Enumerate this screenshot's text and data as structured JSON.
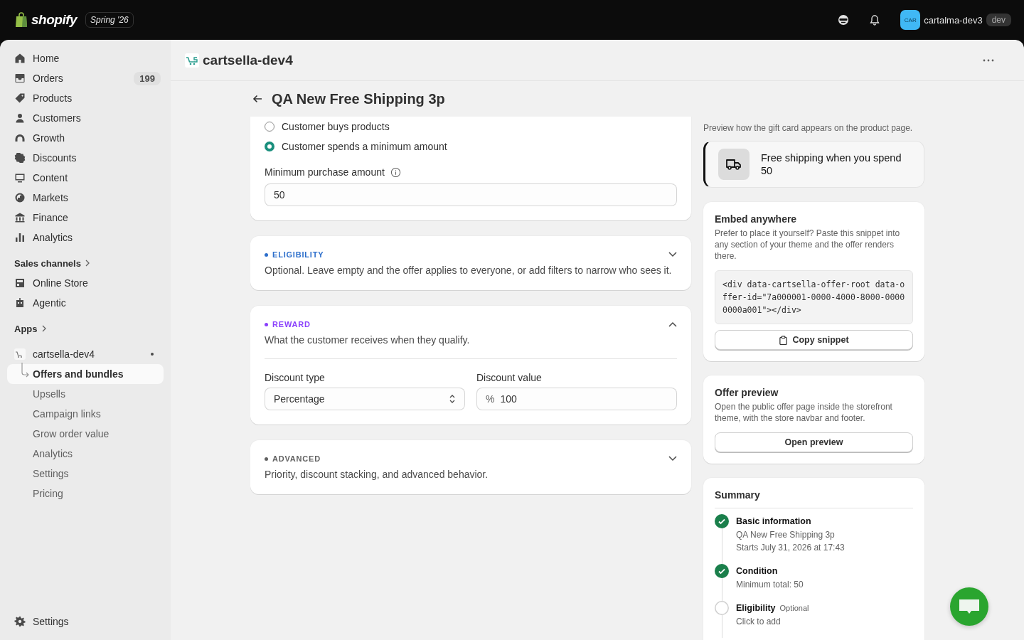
{
  "top_bar": {
    "logo_text": "shopify",
    "release": "Spring '26",
    "avatar": "CAR",
    "store": "cartalma-dev3",
    "env": "dev"
  },
  "sidebar": {
    "items": [
      {
        "label": "Home",
        "selected": false
      },
      {
        "label": "Orders",
        "count": "199",
        "selected": false
      },
      {
        "label": "Products",
        "selected": false
      },
      {
        "label": "Customers",
        "selected": false
      },
      {
        "label": "Growth",
        "selected": false
      },
      {
        "label": "Discounts",
        "selected": false
      },
      {
        "label": "Content",
        "selected": false
      },
      {
        "label": "Markets",
        "selected": false
      },
      {
        "label": "Finance",
        "selected": false
      },
      {
        "label": "Analytics",
        "selected": false
      }
    ],
    "channels_heading": "Sales channels",
    "channels": [
      {
        "label": "Online Store",
        "selected": false
      },
      {
        "label": "Agentic",
        "selected": false
      }
    ],
    "apps_heading": "Apps",
    "app": {
      "name": "cartsella-dev4",
      "children": [
        {
          "label": "Offers and bundles",
          "selected": true
        },
        {
          "label": "Upsells",
          "selected": false
        },
        {
          "label": "Campaign links",
          "selected": false
        },
        {
          "label": "Grow order value",
          "selected": false
        },
        {
          "label": "Analytics",
          "selected": false
        },
        {
          "label": "Settings",
          "selected": false
        },
        {
          "label": "Pricing",
          "selected": false
        }
      ]
    },
    "settings": "Settings"
  },
  "main": {
    "store_title": "cartsella-dev4",
    "page_title": "QA New Free Shipping 3p",
    "condition": {
      "options": [
        {
          "label": "Customer buys products",
          "selected": false
        },
        {
          "label": "Customer spends a minimum amount",
          "selected": true
        }
      ],
      "field_label": "Minimum purchase amount",
      "field_value": "50"
    },
    "sections": [
      {
        "label": "ELIGIBILITY",
        "color": "#2c6ecb",
        "description": "Optional. Leave empty and the offer applies to everyone, or add filters to narrow who sees it.",
        "expanded": false
      },
      {
        "label": "REWARD",
        "color": "#8a3ffc",
        "description": "What the customer receives when they qualify.",
        "expanded": true,
        "discount_type": {
          "label": "Discount type",
          "value": "Percentage"
        },
        "discount_value": {
          "label": "Discount value",
          "prefix": "%",
          "value": "100"
        }
      },
      {
        "label": "ADVANCED",
        "color": "#616161",
        "description": "Priority, discount stacking, and advanced behavior.",
        "expanded": false
      }
    ]
  },
  "aside": {
    "preview_hint": "Preview how the gift card appears on the product page.",
    "preview_text": "Free shipping when you spend 50",
    "embed": {
      "title": "Embed anywhere",
      "description": "Prefer to place it yourself? Paste this snippet into any section of your theme and the offer renders there.",
      "snippet": "<div data-cartsella-offer-root data-offer-id=\"7a000001-0000-4000-8000-00000000a001\"></div>",
      "button": "Copy snippet"
    },
    "offer_preview": {
      "title": "Offer preview",
      "description": "Open the public offer page inside the storefront theme, with the store navbar and footer.",
      "button": "Open preview"
    },
    "summary": {
      "title": "Summary",
      "steps": [
        {
          "title": "Basic information",
          "done": true,
          "lines": [
            "QA New Free Shipping 3p",
            "Starts July 31, 2026 at 17:43"
          ]
        },
        {
          "title": "Condition",
          "done": true,
          "lines": [
            "Minimum total: 50"
          ]
        },
        {
          "title": "Eligibility",
          "tag": "Optional",
          "done": false,
          "lines": [
            "Click to add"
          ]
        }
      ]
    }
  }
}
